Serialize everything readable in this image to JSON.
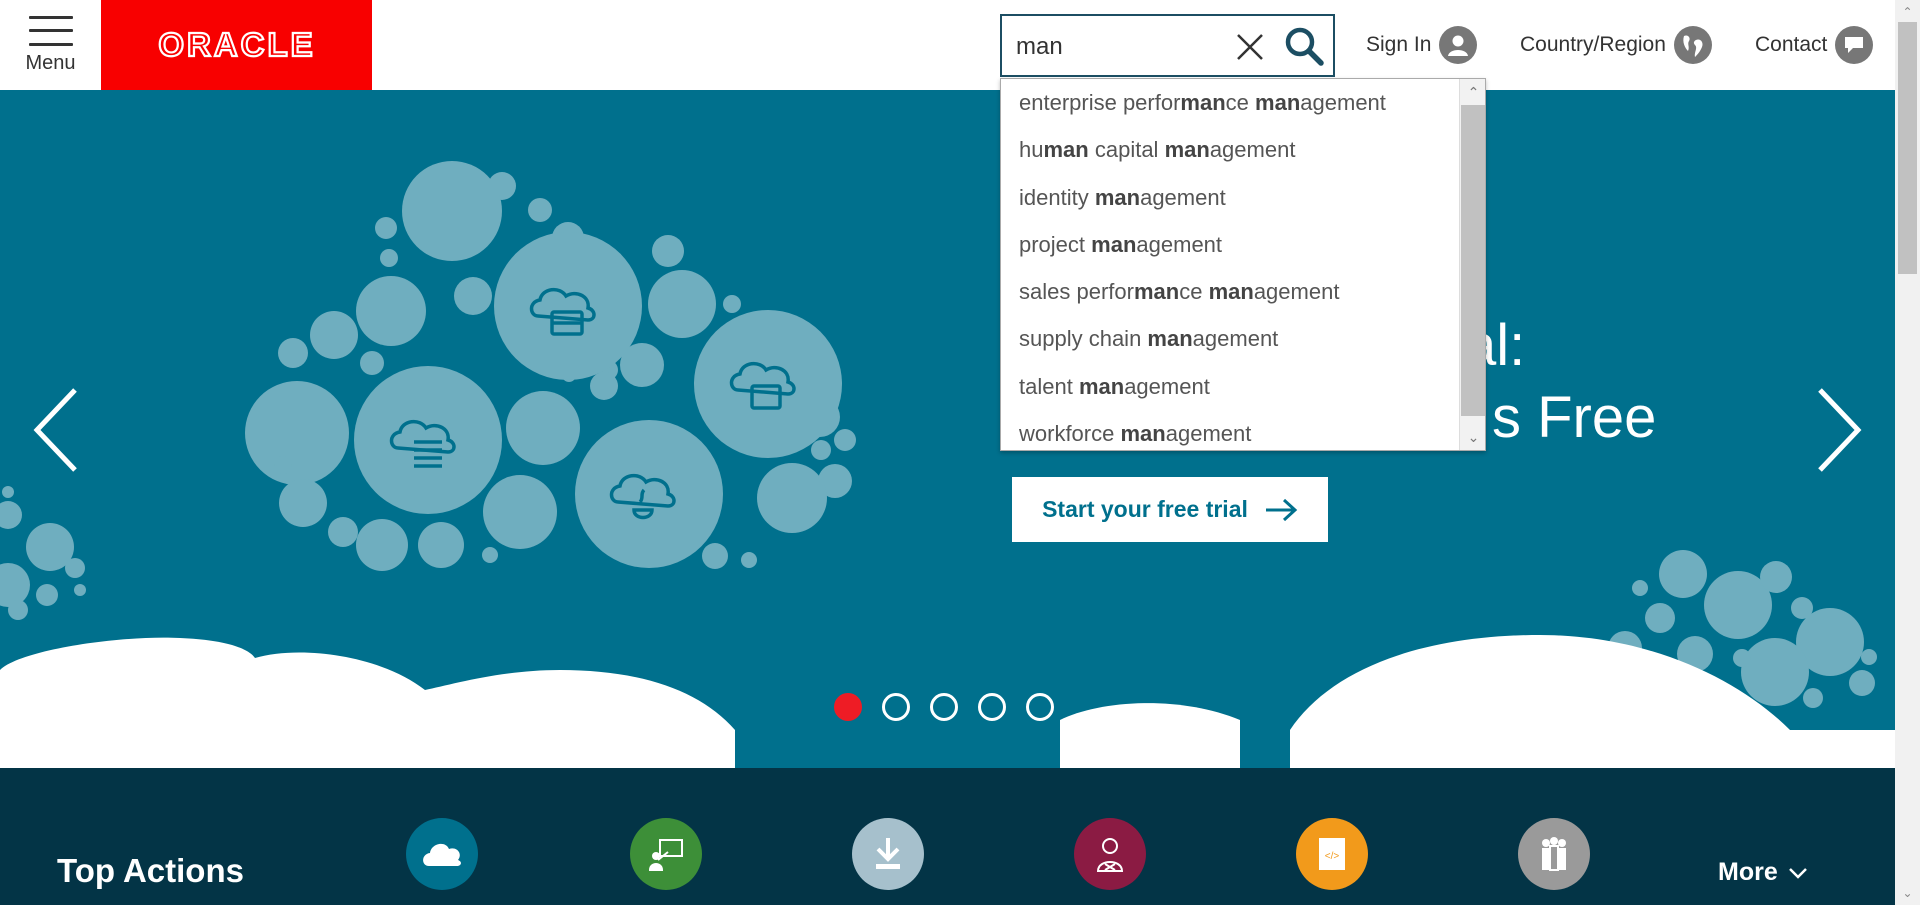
{
  "header": {
    "menu_label": "Menu",
    "logo_text": "ORACLE",
    "search": {
      "value": "man",
      "placeholder": ""
    },
    "sign_in_label": "Sign In",
    "country_label": "Country/Region",
    "contact_label": "Contact"
  },
  "autocomplete": {
    "items": [
      {
        "parts": [
          "enterprise perfor",
          "man",
          "ce ",
          "man",
          "agement"
        ]
      },
      {
        "parts": [
          "hu",
          "man",
          " capital ",
          "man",
          "agement"
        ]
      },
      {
        "parts": [
          "identity ",
          "man",
          "agement"
        ]
      },
      {
        "parts": [
          "project ",
          "man",
          "agement"
        ]
      },
      {
        "parts": [
          "sales perfor",
          "man",
          "ce ",
          "man",
          "agement"
        ]
      },
      {
        "parts": [
          "supply chain ",
          "man",
          "agement"
        ]
      },
      {
        "parts": [
          "talent ",
          "man",
          "agement"
        ]
      },
      {
        "parts": [
          "workforce ",
          "man",
          "agement"
        ]
      }
    ]
  },
  "hero": {
    "heading_line1": "al:",
    "heading_line2": "s Free",
    "cta_label": "Start your free trial",
    "slides_count": 5,
    "active_slide": 1
  },
  "top_actions": {
    "title": "Top Actions",
    "more_label": "More",
    "icons": [
      {
        "name": "cloud-icon",
        "color": "#00708d"
      },
      {
        "name": "presentation-icon",
        "color": "#3d8f38"
      },
      {
        "name": "download-icon",
        "color": "#a6c0cc"
      },
      {
        "name": "support-agent-icon",
        "color": "#8b1b43"
      },
      {
        "name": "code-file-icon",
        "color": "#f29a1b"
      },
      {
        "name": "people-icon",
        "color": "#9a9a9a"
      }
    ]
  },
  "colors": {
    "brand_red": "#f80000",
    "hero_teal": "#00708d",
    "footer_navy": "#033446",
    "active_dot": "#ee1c25"
  }
}
